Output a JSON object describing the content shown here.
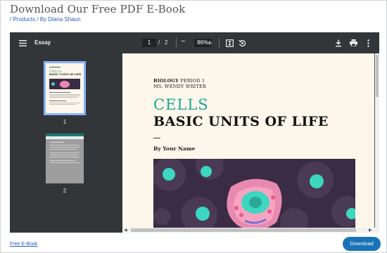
{
  "header": {
    "title": "Download Our Free PDF E-Book",
    "breadcrumb": [
      "/ Products",
      "/ By Diana Shaun"
    ]
  },
  "viewer": {
    "toolbar": {
      "menu_icon": "hamburger-menu-icon",
      "doc_title": "Essay",
      "current_page": "1",
      "page_separator": "/",
      "total_pages": "2",
      "zoom_out_label": "−",
      "zoom_level": "86%",
      "zoom_in_label": "+",
      "fit_icon": "fit-to-page-icon",
      "rotate_icon": "rotate-icon",
      "download_icon": "download-icon",
      "print_icon": "print-icon",
      "more_icon": "more-vert-icon"
    },
    "thumbnails": [
      {
        "number": "1",
        "selected": true
      },
      {
        "number": "2",
        "selected": false
      }
    ],
    "page": {
      "subject_bold": "BIOLOGY",
      "subject_rest": " PERIOD 1",
      "teacher": "MS. WENDY WRITER",
      "title_accent": "CELLS",
      "title_main": "BASIC UNITS OF LIFE",
      "byline": "By Your Name",
      "accent_color": "#1aa595"
    }
  },
  "footer": {
    "link_label": "Free E-Book",
    "download_label": "Download",
    "button_color": "#1a73b8"
  }
}
